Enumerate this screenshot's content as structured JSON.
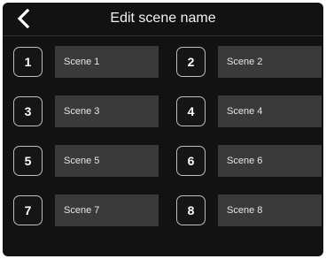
{
  "header": {
    "title": "Edit scene name",
    "back_icon": "chevron-left-icon"
  },
  "scenes": [
    {
      "number": "1",
      "name": "Scene 1"
    },
    {
      "number": "2",
      "name": "Scene 2"
    },
    {
      "number": "3",
      "name": "Scene 3"
    },
    {
      "number": "4",
      "name": "Scene 4"
    },
    {
      "number": "5",
      "name": "Scene 5"
    },
    {
      "number": "6",
      "name": "Scene 6"
    },
    {
      "number": "7",
      "name": "Scene 7"
    },
    {
      "number": "8",
      "name": "Scene 8"
    }
  ],
  "colors": {
    "background": "#121212",
    "field": "#3a3a3a",
    "button_border": "#bdbdbd",
    "text": "#ffffff"
  }
}
